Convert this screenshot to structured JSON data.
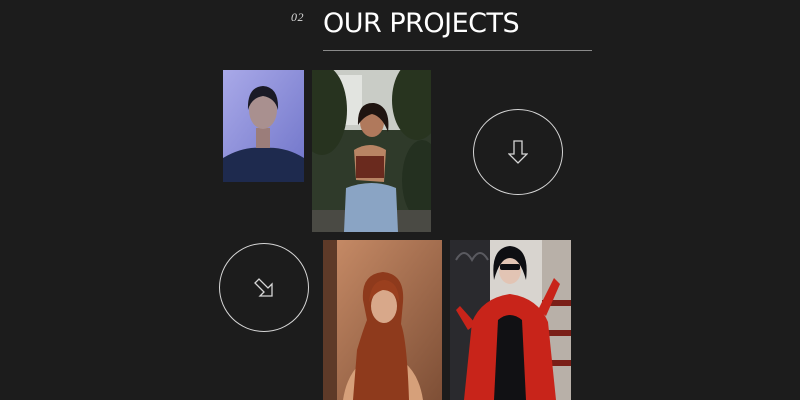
{
  "section": {
    "number": "02",
    "title": "OUR PROJECTS"
  },
  "projects": [
    {
      "photo": "portrait-woman-blue-backdrop"
    },
    {
      "photo": "woman-seated-outdoors-denim"
    },
    {
      "photo": "red-haired-woman-portrait"
    },
    {
      "photo": "woman-red-coat-sunglasses"
    }
  ],
  "controls": {
    "scroll_down_icon": "arrow-down-icon",
    "diagonal_icon": "arrow-down-right-icon"
  },
  "colors": {
    "background": "#1c1c1c",
    "text": "#ffffff",
    "rule": "#8a8a8a",
    "circle_outline": "#d6d6d6"
  }
}
